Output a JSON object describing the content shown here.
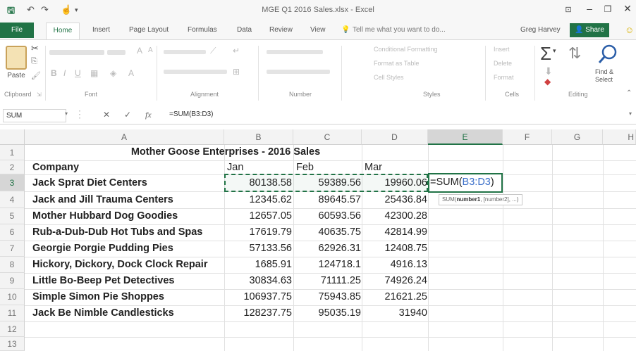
{
  "app": {
    "window_title": "MGE Q1 2016 Sales.xlsx - Excel",
    "user_name": "Greg Harvey",
    "share_label": "Share"
  },
  "tabs": [
    {
      "label": "File"
    },
    {
      "label": "Home"
    },
    {
      "label": "Insert"
    },
    {
      "label": "Page Layout"
    },
    {
      "label": "Formulas"
    },
    {
      "label": "Data"
    },
    {
      "label": "Review"
    },
    {
      "label": "View"
    },
    {
      "label": "Tell me what you want to do..."
    }
  ],
  "ribbon": {
    "paste_label": "Paste",
    "groups": [
      "Clipboard",
      "Font",
      "Alignment",
      "Number",
      "Styles",
      "Cells",
      "Editing"
    ],
    "styles_items": [
      "Conditional Formatting",
      "Format as Table",
      "Cell Styles"
    ],
    "cells_items": [
      "Insert",
      "Delete",
      "Format"
    ],
    "find_select_label_1": "Find &",
    "find_select_label_2": "Select"
  },
  "formula_bar": {
    "name_box": "SUM",
    "cancel_symbol": "✕",
    "enter_symbol": "✓",
    "fx_symbol": "fx",
    "formula": "=SUM(B3:D3)"
  },
  "columns": [
    "A",
    "B",
    "C",
    "D",
    "E",
    "F",
    "G",
    "H"
  ],
  "active_column": "E",
  "rows": [
    "1",
    "2",
    "3",
    "4",
    "5",
    "6",
    "7",
    "8",
    "9",
    "10",
    "11",
    "12",
    "13"
  ],
  "active_row": "3",
  "sheet": {
    "title": "Mother Goose Enterprises - 2016 Sales",
    "headers": {
      "company": "Company",
      "jan": "Jan",
      "feb": "Feb",
      "mar": "Mar"
    },
    "data": [
      {
        "company": "Jack Sprat Diet Centers",
        "jan": "80138.58",
        "feb": "59389.56",
        "mar": "19960.06"
      },
      {
        "company": "Jack and Jill Trauma Centers",
        "jan": "12345.62",
        "feb": "89645.57",
        "mar": "25436.84"
      },
      {
        "company": "Mother Hubbard Dog Goodies",
        "jan": "12657.05",
        "feb": "60593.56",
        "mar": "42300.28"
      },
      {
        "company": "Rub-a-Dub-Dub Hot Tubs and Spas",
        "jan": "17619.79",
        "feb": "40635.75",
        "mar": "42814.99"
      },
      {
        "company": "Georgie Porgie Pudding Pies",
        "jan": "57133.56",
        "feb": "62926.31",
        "mar": "12408.75"
      },
      {
        "company": "Hickory, Dickory,  Dock Clock Repair",
        "jan": "1685.91",
        "feb": "124718.1",
        "mar": "4916.13"
      },
      {
        "company": "Little Bo-Beep Pet Detectives",
        "jan": "30834.63",
        "feb": "71111.25",
        "mar": "74926.24"
      },
      {
        "company": "Simple Simon Pie Shoppes",
        "jan": "106937.75",
        "feb": "75943.85",
        "mar": "21621.25"
      },
      {
        "company": "Jack Be Nimble Candlesticks",
        "jan": "128237.75",
        "feb": "95035.19",
        "mar": "31940"
      }
    ],
    "editing_cell": {
      "prefix": "=SUM(",
      "range_start": "B3",
      "colon": ":",
      "range_end": "D3",
      "suffix": ")"
    },
    "tooltip": {
      "fn": "SUM(",
      "arg1": "number1",
      "rest": ", [number2], ...)"
    }
  }
}
